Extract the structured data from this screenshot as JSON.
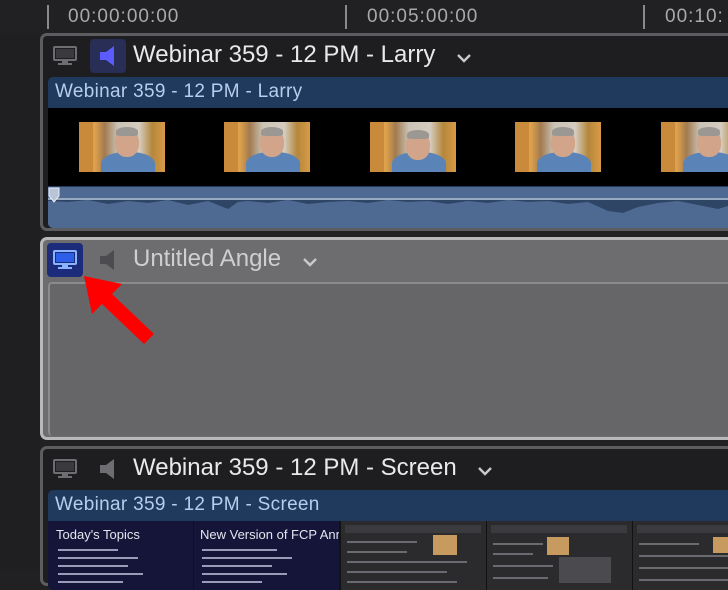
{
  "ruler": {
    "timecodes": [
      "00:00:00:00",
      "00:05:00:00",
      "00:10:"
    ]
  },
  "angles": [
    {
      "name": "Webinar 359 - 12 PM - Larry",
      "clip_title": "Webinar 359 - 12 PM - Larry",
      "video_active": false,
      "audio_active": true
    },
    {
      "name": "Untitled Angle",
      "video_active": true,
      "audio_active": false
    },
    {
      "name": "Webinar 359 - 12 PM - Screen",
      "clip_title": "Webinar 359 - 12 PM - Screen",
      "video_active": false,
      "audio_active": false,
      "slides": [
        {
          "title": "Today's Topics"
        },
        {
          "title": "New Version of FCP Announced"
        }
      ]
    }
  ],
  "icons": {
    "video": "monitor-icon",
    "audio": "speaker-icon",
    "menu": "chevron-down-icon",
    "annotation": "red-arrow"
  },
  "colors": {
    "video_active_bg": "#1c2b7a",
    "audio_active_icon": "#5b5bff",
    "clip_bg": "#1f3a5c",
    "clip_title": "#b7cdee",
    "annotation_arrow": "#ff0000"
  }
}
